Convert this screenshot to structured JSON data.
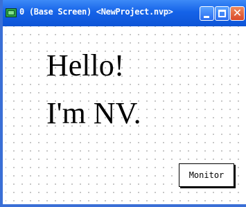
{
  "window": {
    "title": "0 (Base Screen) <NewProject.nvp>",
    "icon": "monitor-app-icon",
    "buttons": {
      "minimize": "minimize-icon",
      "maximize": "maximize-icon",
      "close": "close-icon"
    }
  },
  "canvas": {
    "grid": true,
    "text_line_1": "Hello!",
    "text_line_2": "I'm NV."
  },
  "monitor_button": {
    "label": "Monitor"
  },
  "colors": {
    "titlebar": "#1563e8",
    "border": "#3a6fd6",
    "close": "#d8482a"
  }
}
